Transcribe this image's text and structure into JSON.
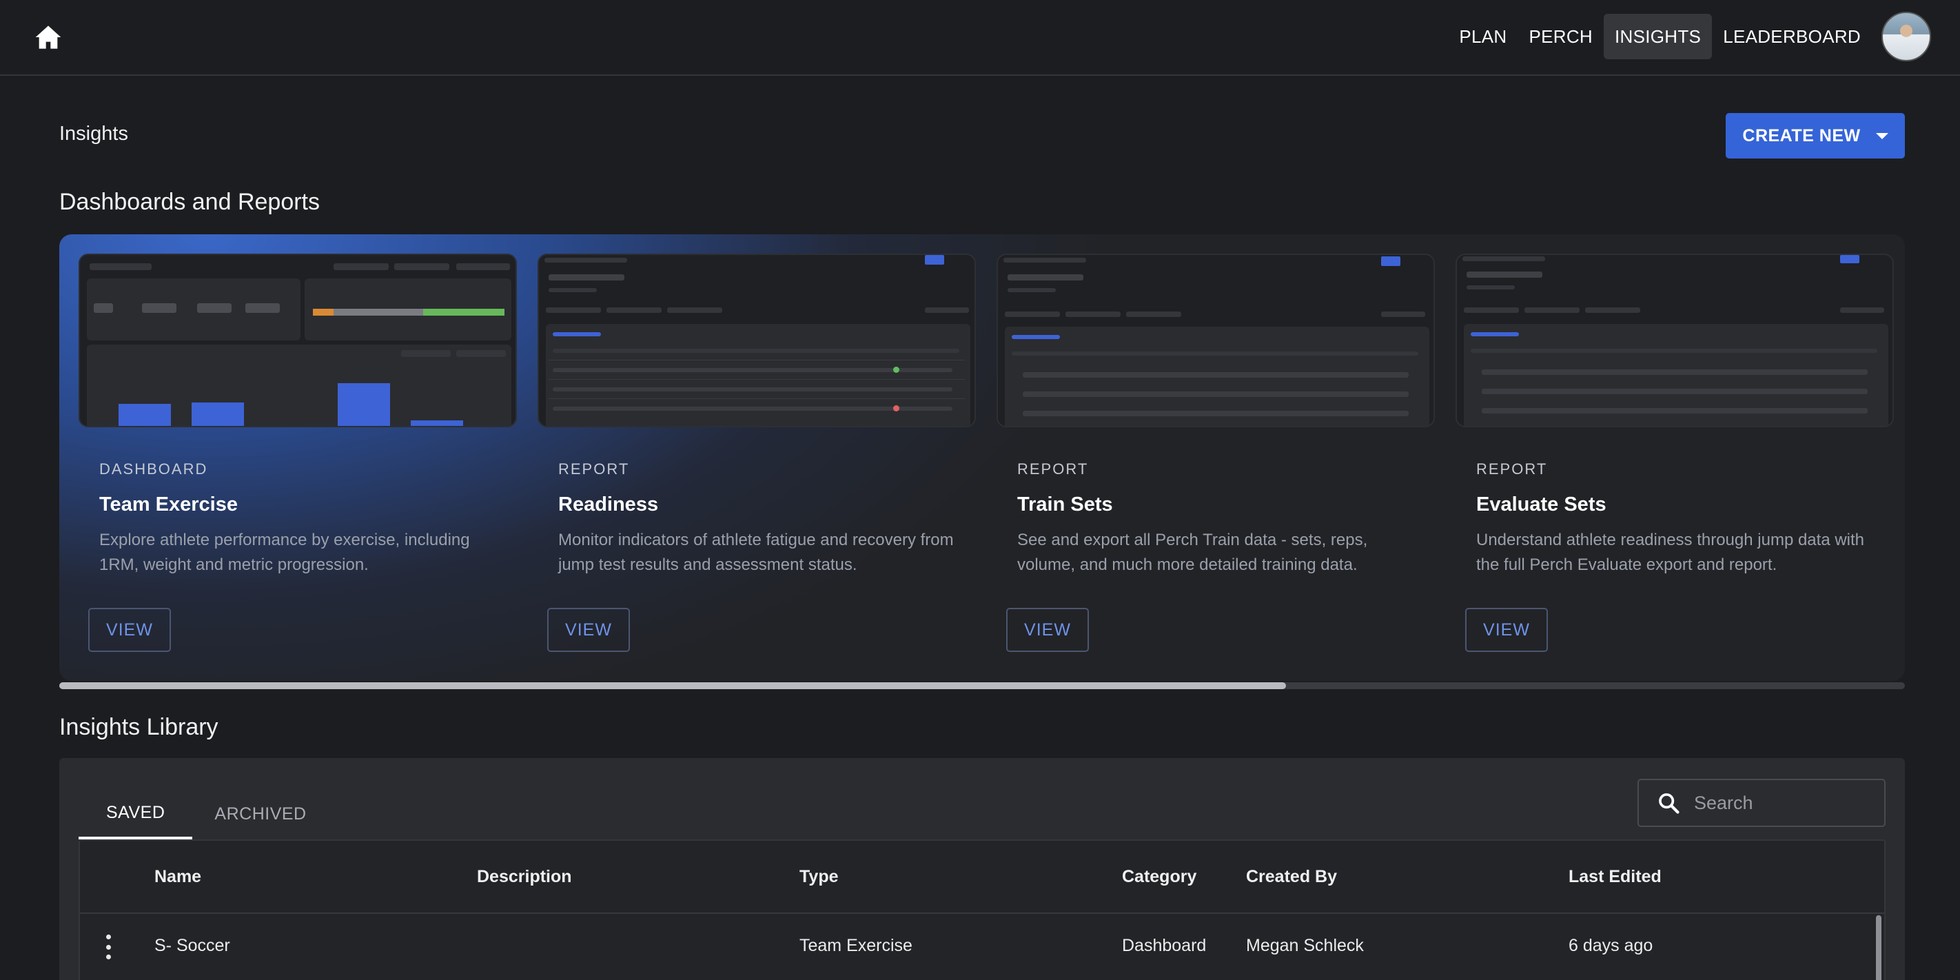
{
  "nav": {
    "items": [
      {
        "label": "PLAN",
        "active": false
      },
      {
        "label": "PERCH",
        "active": false
      },
      {
        "label": "INSIGHTS",
        "active": true
      },
      {
        "label": "LEADERBOARD",
        "active": false
      }
    ]
  },
  "header": {
    "title": "Insights",
    "create_label": "CREATE NEW"
  },
  "dashboards": {
    "title": "Dashboards and Reports",
    "cards": [
      {
        "kicker": "DASHBOARD",
        "title": "Team Exercise",
        "description": "Explore athlete performance by exercise, including 1RM, weight and metric progression.",
        "view_label": "VIEW"
      },
      {
        "kicker": "REPORT",
        "title": "Readiness",
        "description": "Monitor indicators of athlete fatigue and recovery from jump test results and assessment status.",
        "view_label": "VIEW"
      },
      {
        "kicker": "REPORT",
        "title": "Train Sets",
        "description": "See and export all Perch Train data - sets, reps, volume, and much more detailed training data.",
        "view_label": "VIEW"
      },
      {
        "kicker": "REPORT",
        "title": "Evaluate Sets",
        "description": "Understand athlete readiness through jump data with the full Perch Evaluate export and report.",
        "view_label": "VIEW"
      }
    ]
  },
  "library": {
    "title": "Insights Library",
    "tabs": [
      {
        "label": "SAVED",
        "active": true
      },
      {
        "label": "ARCHIVED",
        "active": false
      }
    ],
    "search_placeholder": "Search",
    "columns": [
      "Name",
      "Description",
      "Type",
      "Category",
      "Created By",
      "Last Edited"
    ],
    "rows": [
      {
        "name": "S- Soccer",
        "description": "",
        "type": "Team Exercise",
        "category": "Dashboard",
        "created_by": "Megan Schleck",
        "last_edited": "6 days ago"
      }
    ]
  },
  "colors": {
    "accent": "#3564d8",
    "background": "#1c1d20",
    "panel": "#2b2c30"
  }
}
